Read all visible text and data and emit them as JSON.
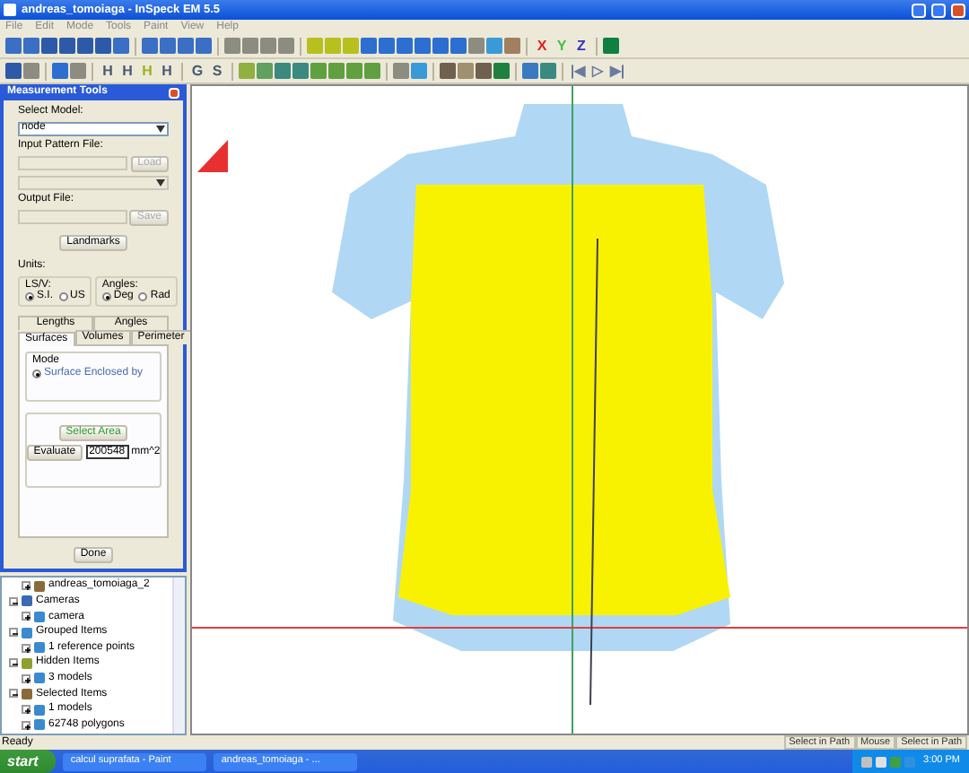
{
  "window": {
    "title": "andreas_tomoiaga - InSpeck EM 5.5"
  },
  "menu": [
    "File",
    "Edit",
    "Mode",
    "Tools",
    "Paint",
    "View",
    "Help"
  ],
  "toolbars": [
    [
      {
        "kind": "icon",
        "color": "#3a6fc4"
      },
      {
        "kind": "icon",
        "color": "#3a6fc4"
      },
      {
        "kind": "icon",
        "color": "#2d5aa8"
      },
      {
        "kind": "icon",
        "color": "#2d5aa8"
      },
      {
        "kind": "icon",
        "color": "#2d5aa8"
      },
      {
        "kind": "icon",
        "color": "#2d5aa8"
      },
      {
        "kind": "icon",
        "color": "#3a6fc4"
      },
      {
        "kind": "sep"
      },
      {
        "kind": "icon",
        "color": "#3a6fc4"
      },
      {
        "kind": "icon",
        "color": "#3a6fc4"
      },
      {
        "kind": "icon",
        "color": "#3a6fc4"
      },
      {
        "kind": "icon",
        "color": "#3a6fc4"
      },
      {
        "kind": "sep"
      },
      {
        "kind": "icon",
        "color": "#8c8c80"
      },
      {
        "kind": "icon",
        "color": "#8c8c80"
      },
      {
        "kind": "icon",
        "color": "#8c8c80"
      },
      {
        "kind": "icon",
        "color": "#8c8c80"
      },
      {
        "kind": "sep"
      },
      {
        "kind": "icon",
        "color": "#b8c020"
      },
      {
        "kind": "icon",
        "color": "#b8c020"
      },
      {
        "kind": "icon",
        "color": "#b8c020"
      },
      {
        "kind": "icon",
        "color": "#2d6fd0"
      },
      {
        "kind": "icon",
        "color": "#2d6fd0"
      },
      {
        "kind": "icon",
        "color": "#2d6fd0"
      },
      {
        "kind": "icon",
        "color": "#2d6fd0"
      },
      {
        "kind": "icon",
        "color": "#2d6fd0"
      },
      {
        "kind": "icon",
        "color": "#2d6fd0"
      },
      {
        "kind": "icon",
        "color": "#8c8c80"
      },
      {
        "kind": "icon",
        "color": "#3a9ad8"
      },
      {
        "kind": "icon",
        "color": "#a08060"
      },
      {
        "kind": "sep"
      },
      {
        "kind": "letter",
        "text": "X",
        "color": "#e02020"
      },
      {
        "kind": "letter",
        "text": "Y",
        "color": "#40c040"
      },
      {
        "kind": "letter",
        "text": "Z",
        "color": "#3030c0"
      },
      {
        "kind": "sep"
      },
      {
        "kind": "icon",
        "color": "#108040"
      }
    ],
    [
      {
        "kind": "icon",
        "color": "#2d5aa8"
      },
      {
        "kind": "icon",
        "color": "#8c8c80"
      },
      {
        "kind": "sep"
      },
      {
        "kind": "icon",
        "color": "#2d6fd0"
      },
      {
        "kind": "icon",
        "color": "#8c8c80"
      },
      {
        "kind": "sep"
      },
      {
        "kind": "letter",
        "text": "H",
        "color": "#4a5a70"
      },
      {
        "kind": "letter",
        "text": "H",
        "color": "#4a5a70"
      },
      {
        "kind": "letter",
        "text": "H",
        "color": "#a0b020"
      },
      {
        "kind": "letter",
        "text": "H",
        "color": "#4a5a70"
      },
      {
        "kind": "sep"
      },
      {
        "kind": "letter",
        "text": "G",
        "color": "#4a5a70"
      },
      {
        "kind": "letter",
        "text": "S",
        "color": "#4a5a70"
      },
      {
        "kind": "sep"
      },
      {
        "kind": "icon",
        "color": "#90b040"
      },
      {
        "kind": "icon",
        "color": "#60a060"
      },
      {
        "kind": "icon",
        "color": "#3a8a80"
      },
      {
        "kind": "icon",
        "color": "#3a8a80"
      },
      {
        "kind": "icon",
        "color": "#60a040"
      },
      {
        "kind": "icon",
        "color": "#60a040"
      },
      {
        "kind": "icon",
        "color": "#60a040"
      },
      {
        "kind": "icon",
        "color": "#60a040"
      },
      {
        "kind": "sep"
      },
      {
        "kind": "icon",
        "color": "#8c8c80"
      },
      {
        "kind": "icon",
        "color": "#3a9ad8"
      },
      {
        "kind": "sep"
      },
      {
        "kind": "icon",
        "color": "#706050"
      },
      {
        "kind": "icon",
        "color": "#a09070"
      },
      {
        "kind": "icon",
        "color": "#706050"
      },
      {
        "kind": "icon",
        "color": "#208040"
      },
      {
        "kind": "sep"
      },
      {
        "kind": "icon",
        "color": "#3a7ac0"
      },
      {
        "kind": "icon",
        "color": "#3a8a80"
      },
      {
        "kind": "sep"
      },
      {
        "kind": "letter",
        "text": "|◀",
        "color": "#6a7aa0"
      },
      {
        "kind": "letter",
        "text": "▷",
        "color": "#6a7aa0"
      },
      {
        "kind": "letter",
        "text": "▶|",
        "color": "#6a7aa0"
      }
    ]
  ],
  "measurement_tools": {
    "title": "Measurement Tools",
    "select_model": {
      "label": "Select Model:",
      "value": "node"
    },
    "input_pattern_file": {
      "label": "Input Pattern File:",
      "button": "Load",
      "disabled": true
    },
    "output_file": {
      "label": "Output File:",
      "button": "Save",
      "disabled": true
    },
    "landmarks_button": "Landmarks",
    "units": {
      "label": "Units:",
      "groups": [
        {
          "label": "LS/V:",
          "options": [
            {
              "label": "S.I.",
              "selected": true
            },
            {
              "label": "US",
              "selected": false
            }
          ]
        },
        {
          "label": "Angles:",
          "options": [
            {
              "label": "Deg",
              "selected": true
            },
            {
              "label": "Rad",
              "selected": false
            }
          ]
        }
      ]
    },
    "tabs": [
      [
        {
          "label": "Lengths",
          "selected": false
        },
        {
          "label": "Angles",
          "selected": false
        }
      ],
      [
        {
          "label": "Surfaces",
          "selected": true
        },
        {
          "label": "Volumes",
          "selected": false
        },
        {
          "label": "Perimeter",
          "selected": false
        }
      ]
    ],
    "mode": {
      "label": "Mode",
      "options": [
        {
          "label": "Surface Enclosed by",
          "selected": true
        }
      ]
    },
    "select_area_button": "Select Area",
    "evaluate_button": "Evaluate",
    "result": "200548",
    "unit": "mm^2",
    "done_button": "Done"
  },
  "tree": {
    "continued": [
      {
        "label": "andreas_tomoiaga_2",
        "expanded": false
      }
    ],
    "items": [
      {
        "label": "Cameras",
        "expanded": true,
        "children": [
          {
            "label": "camera",
            "expanded": false
          }
        ]
      },
      {
        "label": "Grouped Items",
        "expanded": true,
        "children": [
          {
            "label": "1 reference points",
            "expanded": false
          }
        ]
      },
      {
        "label": "Hidden Items",
        "expanded": true,
        "children": [
          {
            "label": "3 models",
            "expanded": false
          }
        ]
      },
      {
        "label": "Selected Items",
        "expanded": true,
        "children": [
          {
            "label": "1 models",
            "expanded": false
          },
          {
            "label": "62748 polygons",
            "expanded": false
          }
        ]
      }
    ]
  },
  "status_bar": {
    "text": "Ready",
    "panels": [
      "Select in Path",
      "Mouse",
      "Select in Path"
    ]
  },
  "taskbar": {
    "start": "start",
    "tasks": [
      "calcul suprafata - Paint",
      "andreas_tomoiaga - ..."
    ],
    "clock": "3:00 PM"
  }
}
